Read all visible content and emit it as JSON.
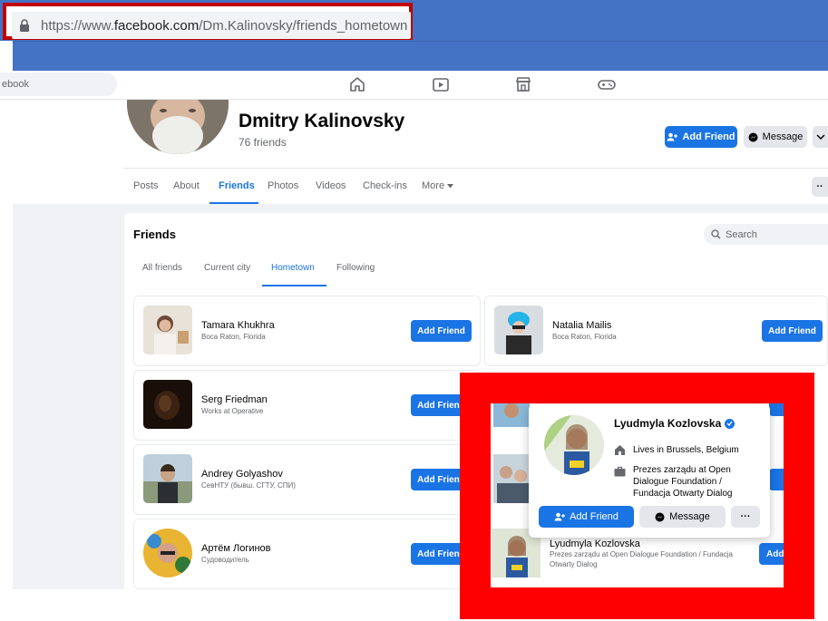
{
  "browser": {
    "url_prefix": "https://www.",
    "url_domain": "facebook.com",
    "url_path": "/Dm.Kalinovsky/friends_hometown"
  },
  "fbnav": {
    "search_placeholder": "ebook",
    "icons": [
      "home-icon",
      "watch-icon",
      "marketplace-icon",
      "gaming-icon"
    ]
  },
  "profile": {
    "name": "Dmitry Kalinovsky",
    "friends_count": "76 friends",
    "add_friend_label": "Add Friend",
    "message_label": "Message"
  },
  "tabs": [
    "Posts",
    "About",
    "Friends",
    "Photos",
    "Videos",
    "Check-ins",
    "More"
  ],
  "friends_section": {
    "title": "Friends",
    "search_placeholder": "Search",
    "subtabs": [
      "All friends",
      "Current city",
      "Hometown",
      "Following"
    ]
  },
  "friends_list": [
    {
      "name": "Tamara Khukhra",
      "sub": "Boca Raton, Florida",
      "button": "Add Friend"
    },
    {
      "name": "Natalia Mailis",
      "sub": "Boca Raton, Florida",
      "button": "Add Friend"
    },
    {
      "name": "Serg Friedman",
      "sub": "Works at Operative",
      "button": "Add Friend"
    },
    {
      "name": "Andrey Golyashov",
      "sub": "СевНТУ (бывш. СГТУ, СПИ)",
      "button": "Add Friend"
    },
    {
      "name": "Артём Логинов",
      "sub": "Судоводитель",
      "button": "Add Friend"
    }
  ],
  "hidden_row": {
    "name": "Lyudmyla Kozlovska",
    "sub_line1": "Prezes zarządu at Open Dialogue Foundation / Fundacja",
    "sub_line2": "Otwarty Dialog",
    "button": "Add"
  },
  "hovercard": {
    "name": "Lyudmyla Kozlovska",
    "lives_prefix": "Lives in ",
    "lives_city": "Brussels, Belgium",
    "work_prefix": "Prezes zarządu at ",
    "work_line1": "Open",
    "work_line2": "Dialogue Foundation /",
    "work_line3": "Fundacja Otwarty Dialog",
    "add_friend_label": "Add Friend",
    "message_label": "Message",
    "more_label": "···"
  },
  "colors": {
    "fb_blue": "#1b74e4",
    "highlight_red": "#ff0000",
    "strip_blue": "#4472c4"
  }
}
